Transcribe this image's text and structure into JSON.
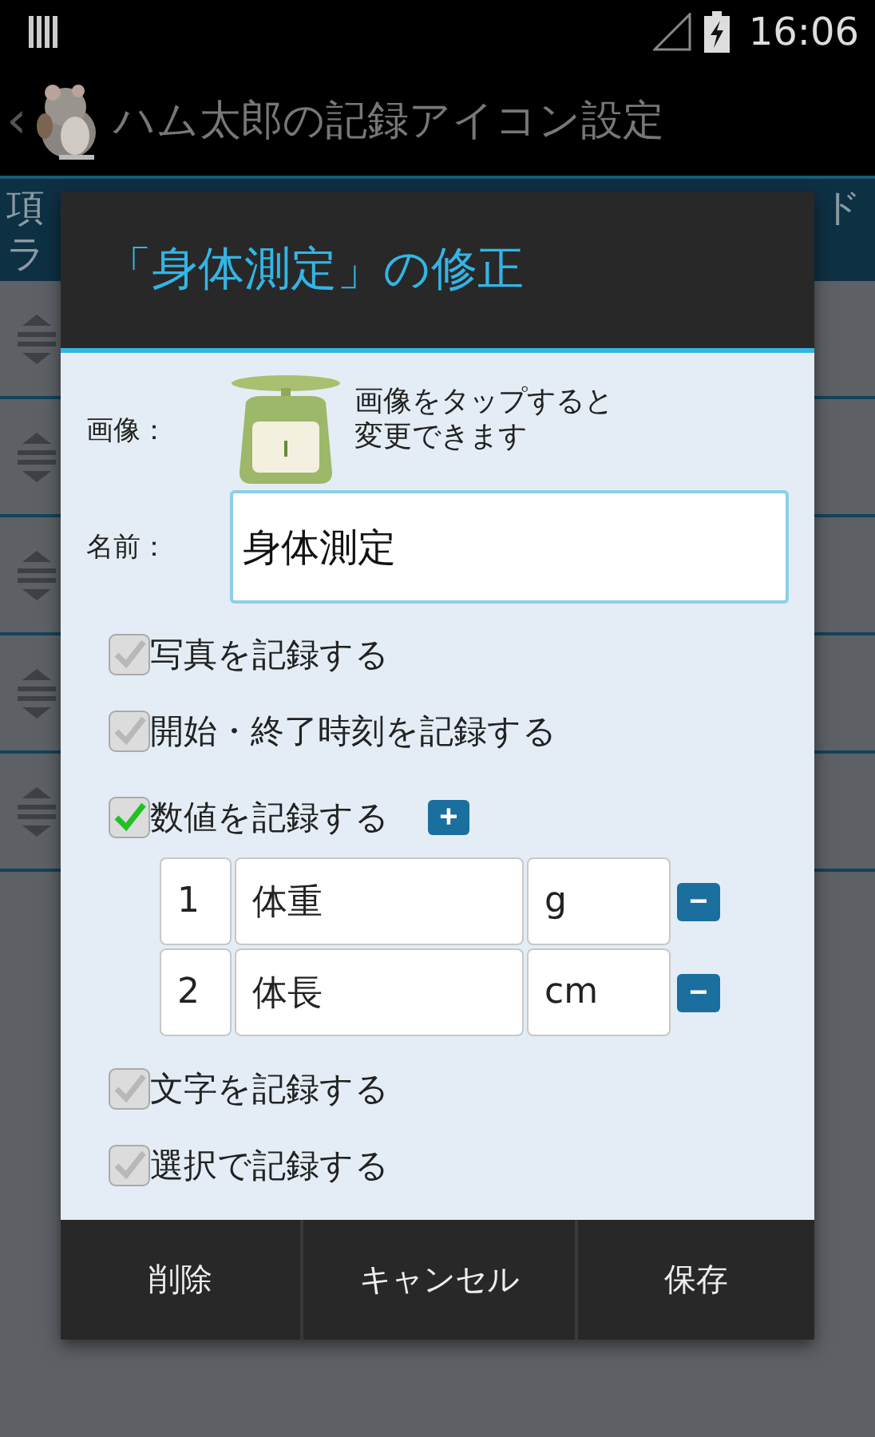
{
  "status_bar": {
    "time": "16:06"
  },
  "action_bar": {
    "back": "‹",
    "title": "ハム太郎の記録アイコン設定"
  },
  "banner": {
    "line_1_start": "項",
    "line_1_end": "ド",
    "line_2_start": "ラ"
  },
  "dialog": {
    "title": "「身体測定」の修正",
    "image_label": "画像：",
    "image_hint": [
      "画像をタップすると",
      "変更できます"
    ],
    "name_label": "名前：",
    "name_value": "身体測定",
    "options": [
      {
        "label": "写真を記録する",
        "checked": false,
        "kind": "plain"
      },
      {
        "label": "開始・終了時刻を記録する",
        "checked": false,
        "kind": "plain"
      },
      {
        "label": "数値を記録する",
        "checked": true,
        "kind": "numeric",
        "add": "+",
        "fields": [
          {
            "number": "1",
            "name": "体重",
            "unit": "g",
            "remove": "−"
          },
          {
            "number": "2",
            "name": "体長",
            "unit": "cm",
            "remove": "−"
          }
        ]
      },
      {
        "label": "文字を記録する",
        "checked": false,
        "kind": "plain"
      },
      {
        "label": "選択で記録する",
        "checked": false,
        "kind": "plain"
      }
    ],
    "buttons": [
      "削除",
      "キャンセル",
      "保存"
    ]
  }
}
